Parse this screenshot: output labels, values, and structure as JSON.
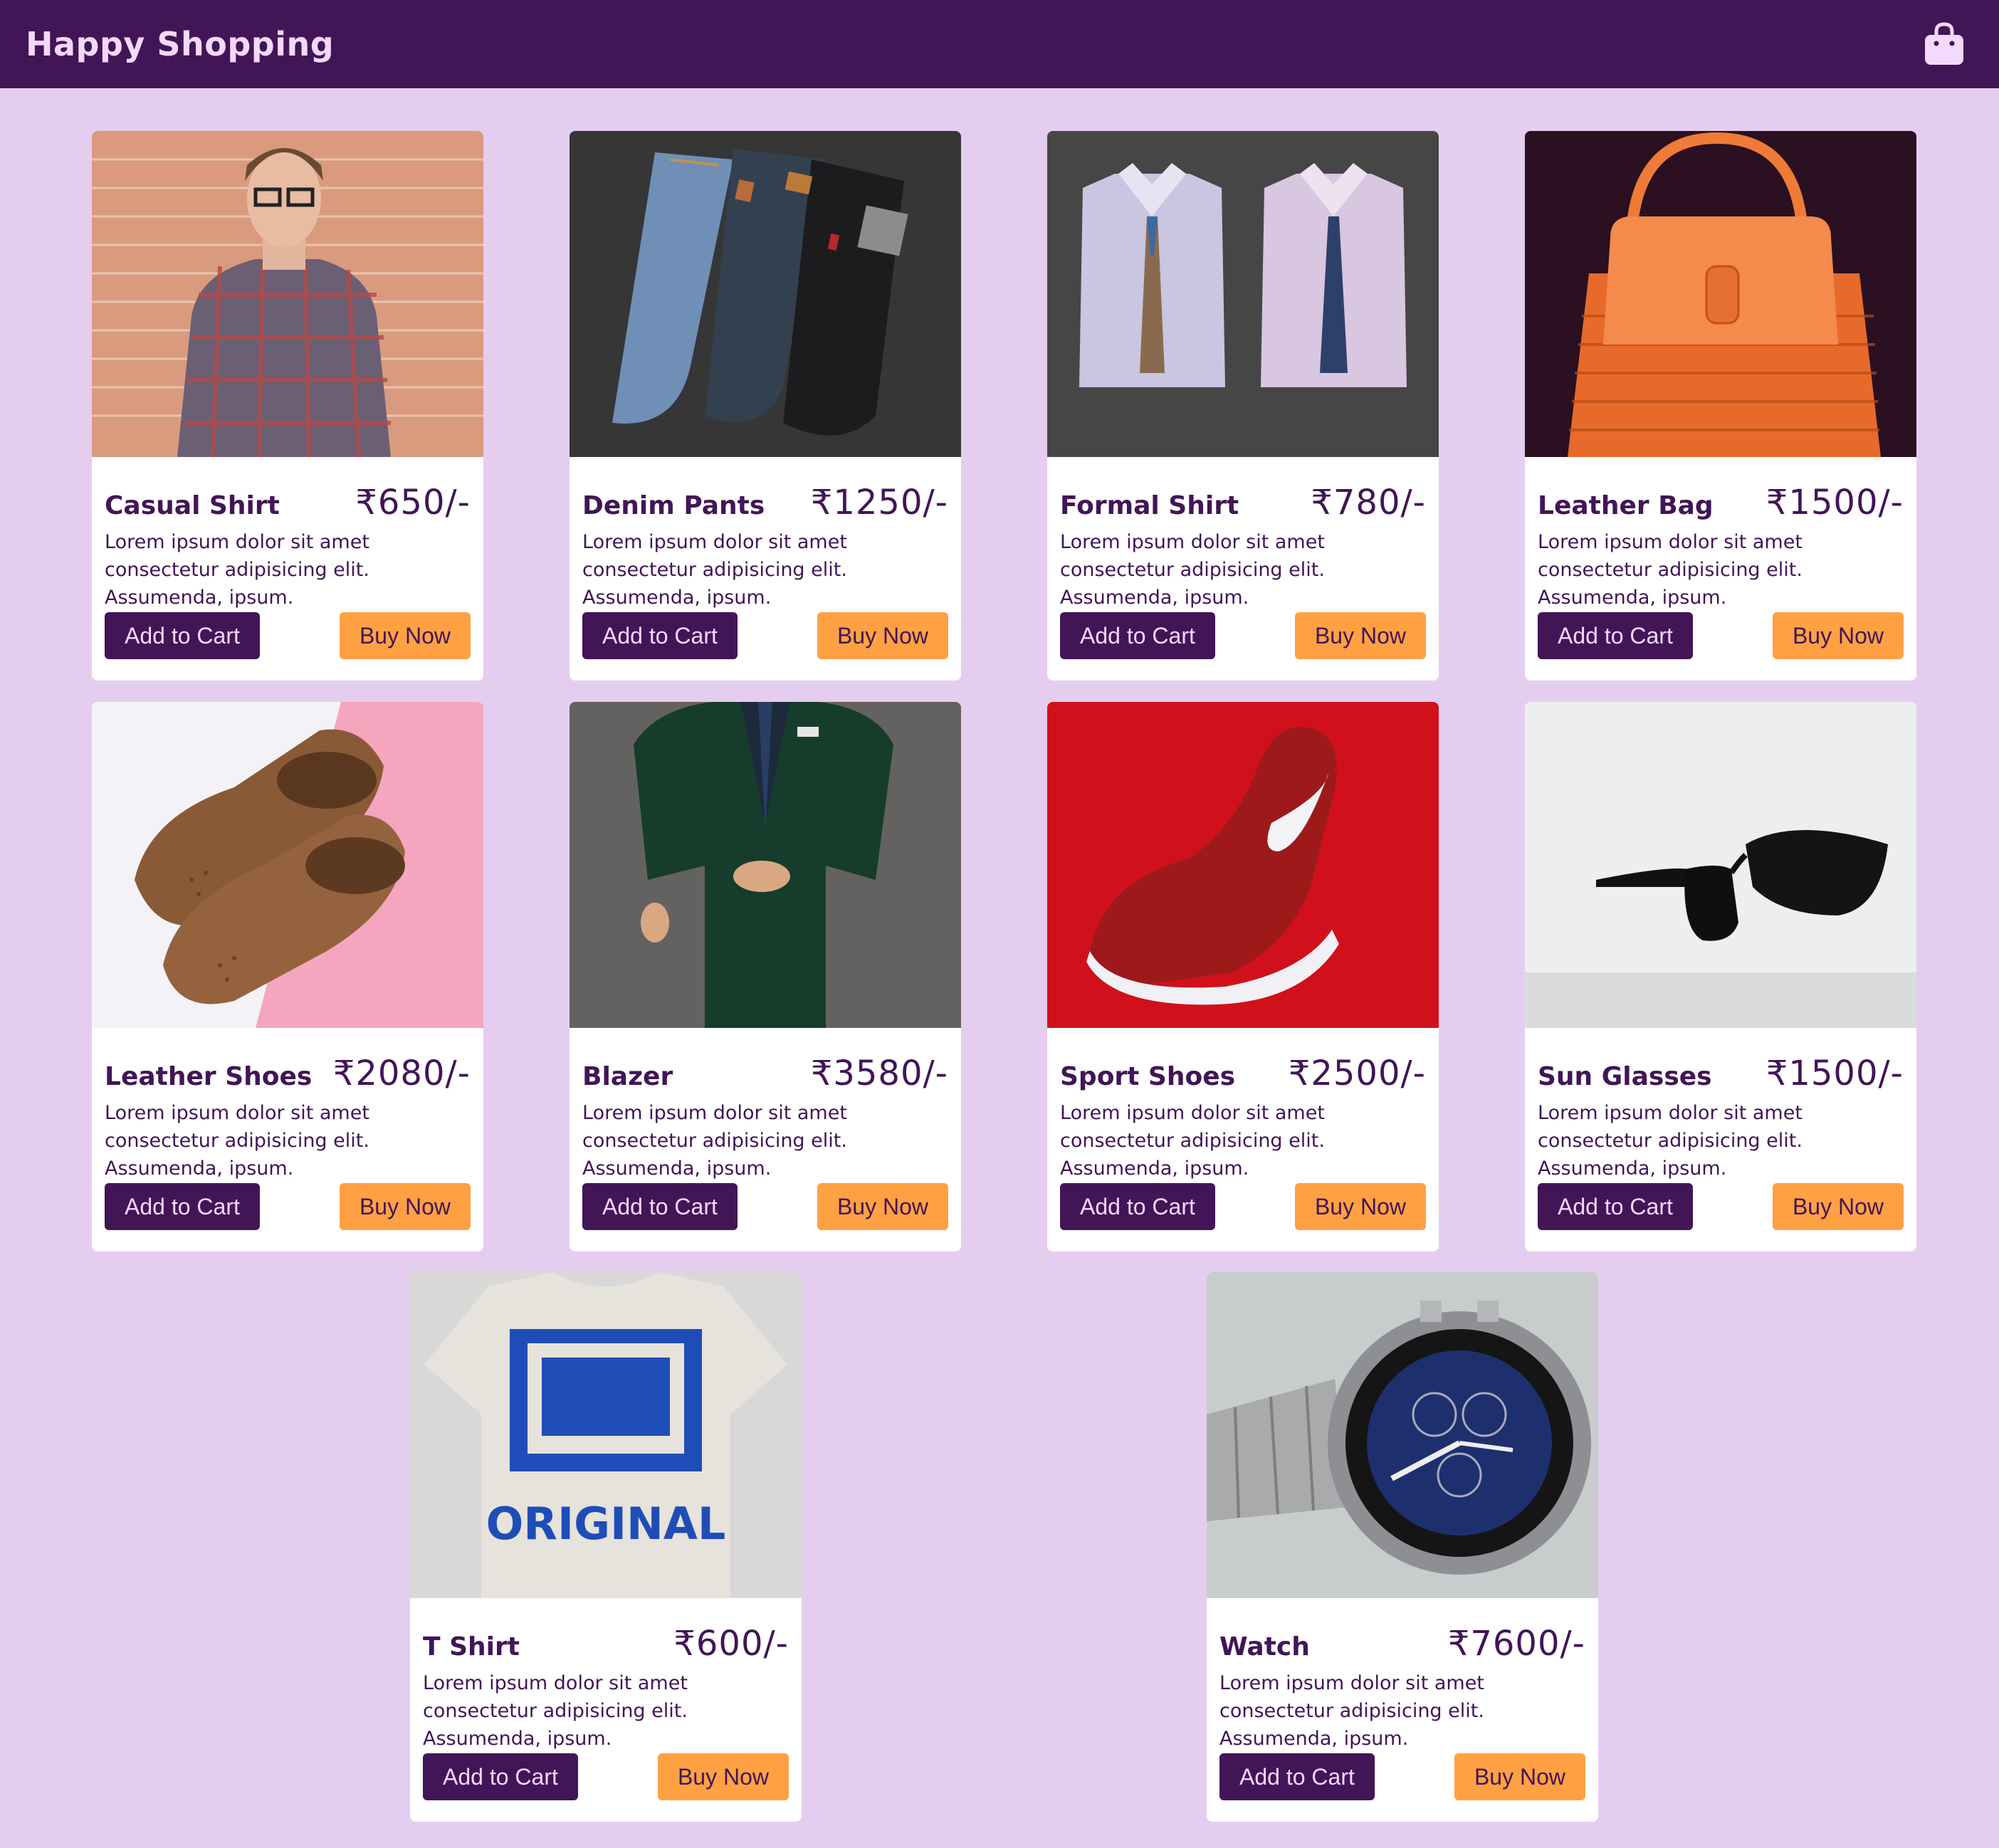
{
  "navbar": {
    "brand": "Happy Shopping",
    "cart_icon": "shopping-bag-icon"
  },
  "colors": {
    "nav_bg": "#421557",
    "page_bg": "#e5cdf0",
    "brand_text": "#f4d9ff",
    "primary": "#421557",
    "accent": "#ffa143"
  },
  "products": [
    {
      "name": "Casual Shirt",
      "price": "₹650/-",
      "description": "Lorem ipsum dolor sit amet consectetur adipisicing elit. Assumenda, ipsum.",
      "add_to_cart": "Add to Cart",
      "buy_now": "Buy Now"
    },
    {
      "name": "Denim Pants",
      "price": "₹1250/-",
      "description": "Lorem ipsum dolor sit amet consectetur adipisicing elit. Assumenda, ipsum.",
      "add_to_cart": "Add to Cart",
      "buy_now": "Buy Now"
    },
    {
      "name": "Formal Shirt",
      "price": "₹780/-",
      "description": "Lorem ipsum dolor sit amet consectetur adipisicing elit. Assumenda, ipsum.",
      "add_to_cart": "Add to Cart",
      "buy_now": "Buy Now"
    },
    {
      "name": "Leather Bag",
      "price": "₹1500/-",
      "description": "Lorem ipsum dolor sit amet consectetur adipisicing elit. Assumenda, ipsum.",
      "add_to_cart": "Add to Cart",
      "buy_now": "Buy Now"
    },
    {
      "name": "Leather Shoes",
      "price": "₹2080/-",
      "description": "Lorem ipsum dolor sit amet consectetur adipisicing elit. Assumenda, ipsum.",
      "add_to_cart": "Add to Cart",
      "buy_now": "Buy Now"
    },
    {
      "name": "Blazer",
      "price": "₹3580/-",
      "description": "Lorem ipsum dolor sit amet consectetur adipisicing elit. Assumenda, ipsum.",
      "add_to_cart": "Add to Cart",
      "buy_now": "Buy Now"
    },
    {
      "name": "Sport Shoes",
      "price": "₹2500/-",
      "description": "Lorem ipsum dolor sit amet consectetur adipisicing elit. Assumenda, ipsum.",
      "add_to_cart": "Add to Cart",
      "buy_now": "Buy Now"
    },
    {
      "name": "Sun Glasses",
      "price": "₹1500/-",
      "description": "Lorem ipsum dolor sit amet consectetur adipisicing elit. Assumenda, ipsum.",
      "add_to_cart": "Add to Cart",
      "buy_now": "Buy Now"
    },
    {
      "name": "T Shirt",
      "price": "₹600/-",
      "description": "Lorem ipsum dolor sit amet consectetur adipisicing elit. Assumenda, ipsum.",
      "add_to_cart": "Add to Cart",
      "buy_now": "Buy Now",
      "image_text": "ORIGINAL"
    },
    {
      "name": "Watch",
      "price": "₹7600/-",
      "description": "Lorem ipsum dolor sit amet consectetur adipisicing elit. Assumenda, ipsum.",
      "add_to_cart": "Add to Cart",
      "buy_now": "Buy Now"
    }
  ]
}
